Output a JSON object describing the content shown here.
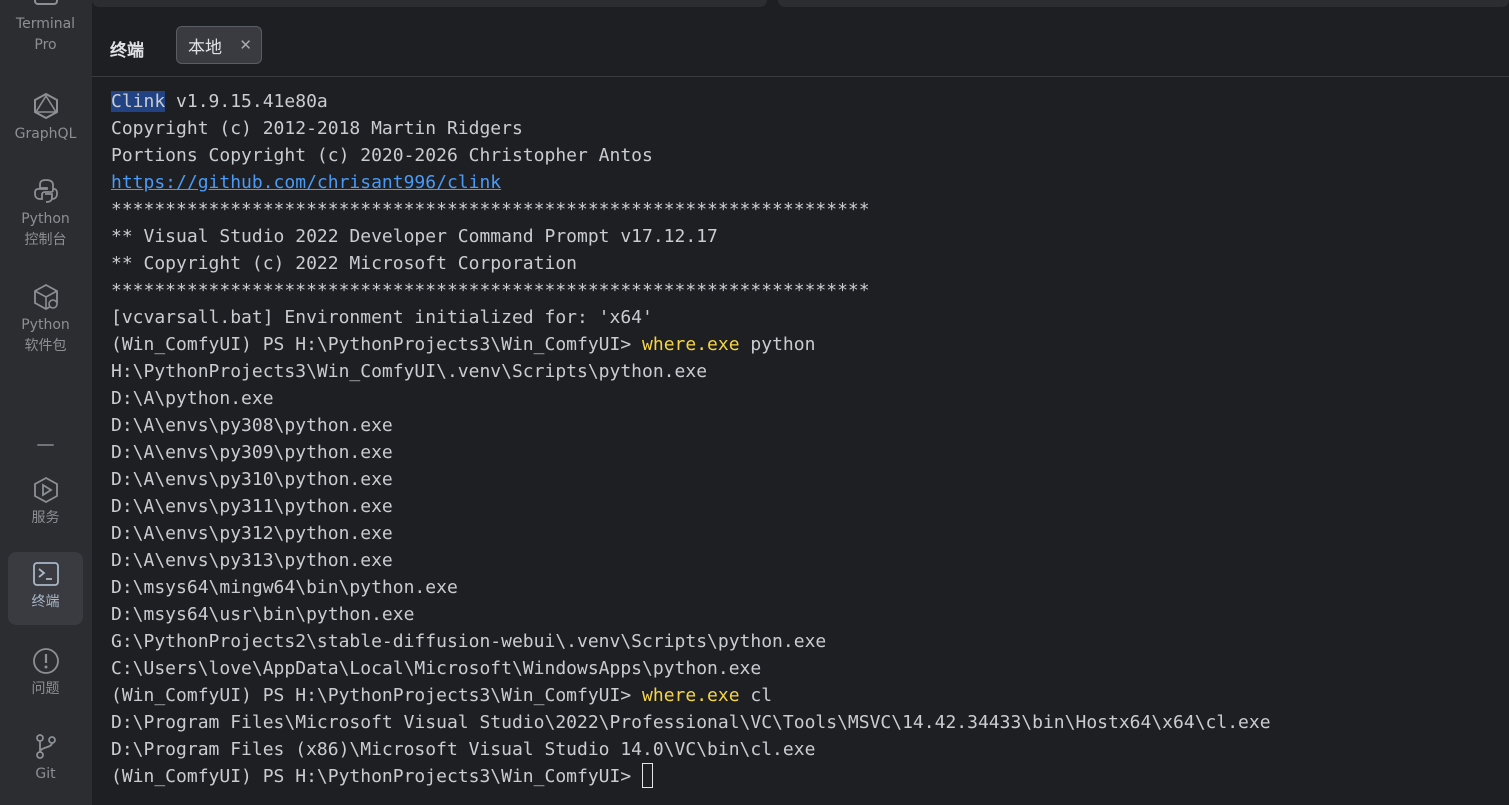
{
  "sidebar": {
    "items": [
      {
        "label": "Terminal\nPro",
        "icon": "terminal-icon"
      },
      {
        "label": "GraphQL",
        "icon": "graphql-icon"
      },
      {
        "label": "Python\n控制台",
        "icon": "python-icon"
      },
      {
        "label": "Python\n软件包",
        "icon": "python-packages-icon"
      },
      {
        "label": "服务",
        "icon": "services-icon"
      },
      {
        "label": "终端",
        "icon": "terminal-icon",
        "active": true
      },
      {
        "label": "问题",
        "icon": "problems-icon"
      },
      {
        "label": "Git",
        "icon": "git-icon"
      }
    ]
  },
  "panel": {
    "title": "终端",
    "tab": {
      "label": "本地",
      "close_glyph": "✕"
    }
  },
  "terminal": {
    "clink_name": "Clink",
    "clink_version": " v1.9.15.41e80a",
    "copyright1": "Copyright (c) 2012-2018 Martin Ridgers",
    "copyright2": "Portions Copyright (c) 2020-2026 Christopher Antos",
    "url": "https://github.com/chrisant996/clink",
    "stars": "**********************************************************************",
    "vs_prompt": "** Visual Studio 2022 Developer Command Prompt v17.12.17",
    "vs_copyright": "** Copyright (c) 2022 Microsoft Corporation",
    "vcvars": "[vcvarsall.bat] Environment initialized for: 'x64'",
    "prompt": "(Win_ComfyUI) PS H:\\PythonProjects3\\Win_ComfyUI> ",
    "cmd1": "where.exe",
    "cmd1_arg": " python",
    "python_results": [
      "H:\\PythonProjects3\\Win_ComfyUI\\.venv\\Scripts\\python.exe",
      "D:\\A\\python.exe",
      "D:\\A\\envs\\py308\\python.exe",
      "D:\\A\\envs\\py309\\python.exe",
      "D:\\A\\envs\\py310\\python.exe",
      "D:\\A\\envs\\py311\\python.exe",
      "D:\\A\\envs\\py312\\python.exe",
      "D:\\A\\envs\\py313\\python.exe",
      "D:\\msys64\\mingw64\\bin\\python.exe",
      "D:\\msys64\\usr\\bin\\python.exe",
      "G:\\PythonProjects2\\stable-diffusion-webui\\.venv\\Scripts\\python.exe",
      "C:\\Users\\love\\AppData\\Local\\Microsoft\\WindowsApps\\python.exe"
    ],
    "cmd2": "where.exe",
    "cmd2_arg": " cl",
    "cl_results": [
      "D:\\Program Files\\Microsoft Visual Studio\\2022\\Professional\\VC\\Tools\\MSVC\\14.42.34433\\bin\\Hostx64\\x64\\cl.exe",
      "D:\\Program Files (x86)\\Microsoft Visual Studio 14.0\\VC\\bin\\cl.exe"
    ]
  }
}
